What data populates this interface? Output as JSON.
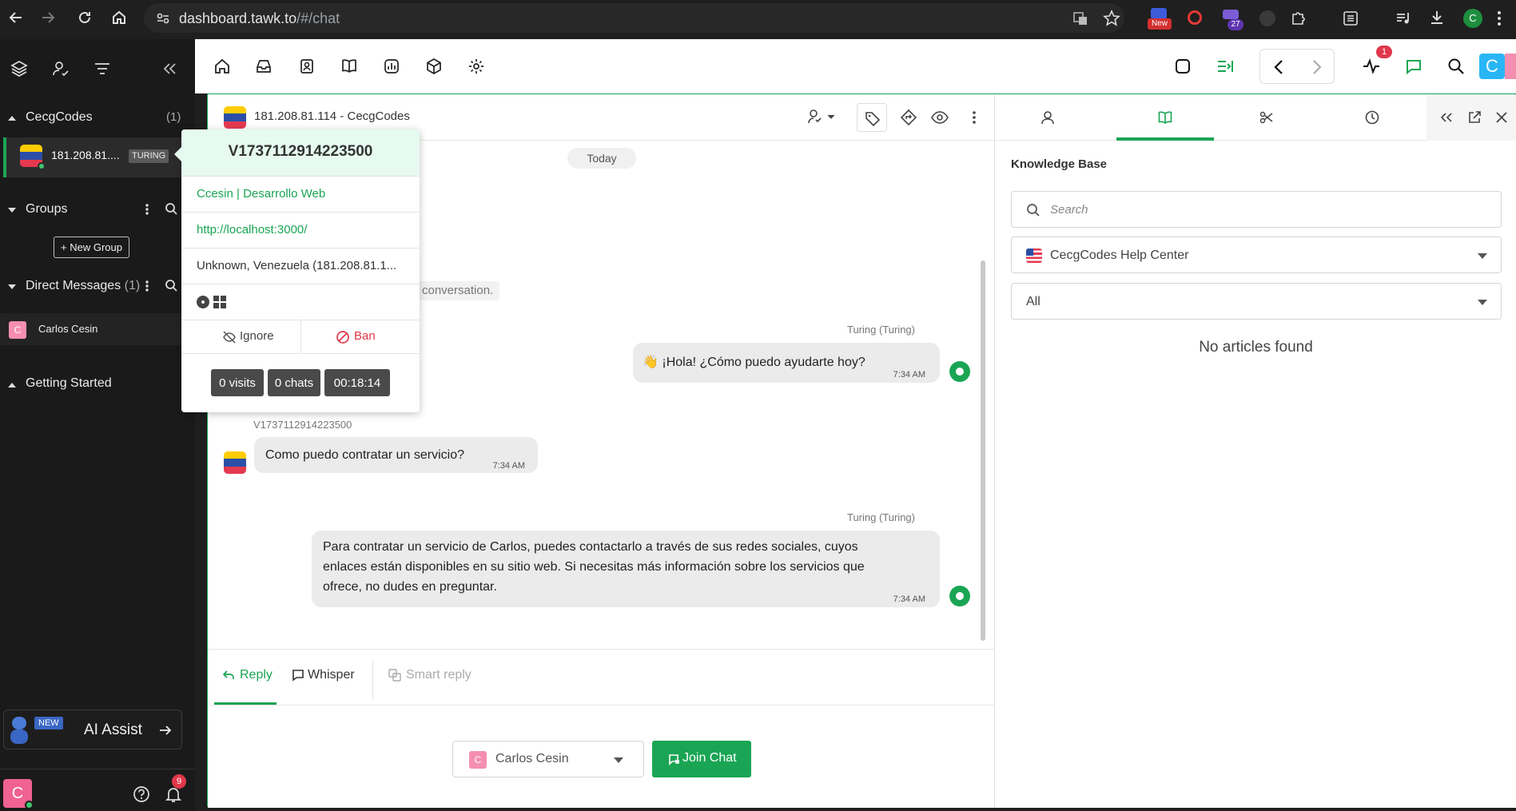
{
  "browser": {
    "url_host": "dashboard.tawk.to",
    "url_path": "/#/chat",
    "ext_badge_new": "New",
    "ext_badge_count": "27",
    "profile_initial": "C"
  },
  "sidebar": {
    "property_name": "CecgCodes",
    "property_count": "(1)",
    "active_chat": {
      "label": "181.208.81....",
      "badge": "TURING"
    },
    "groups_title": "Groups",
    "new_group_label": "New Group",
    "dm_title": "Direct Messages",
    "dm_count": "(1)",
    "dm_items": [
      {
        "initial": "C",
        "name": "Carlos Cesin"
      }
    ],
    "getting_started": "Getting Started",
    "ai_assist": {
      "new_badge": "NEW",
      "label": "AI Assist"
    },
    "user_initial": "C",
    "notification_count": "9"
  },
  "toolbar": {
    "activity_badge": "1",
    "user_initial": "C"
  },
  "chat": {
    "title": "181.208.81.114 - CecgCodes",
    "date_divider": "Today",
    "system_note": "conversation.",
    "messages": [
      {
        "sender": "Turing (Turing)",
        "text": "👋 ¡Hola! ¿Cómo puedo ayudarte hoy?",
        "time": "7:34 AM"
      },
      {
        "sender": "V1737112914223500",
        "text": "Como puedo contratar un servicio?",
        "time": "7:34 AM"
      },
      {
        "sender": "Turing (Turing)",
        "text_lines": [
          "Para contratar un servicio de Carlos, puedes contactarlo a través de sus redes sociales, cuyos",
          "enlaces están disponibles en su sitio web. Si necesitas más información sobre los servicios que",
          "ofrece, no dudes en preguntar."
        ],
        "time": "7:34 AM"
      }
    ]
  },
  "reply": {
    "tabs": [
      "Reply",
      "Whisper",
      "Smart reply"
    ],
    "agent_initial": "C",
    "agent_name": "Carlos Cesin",
    "join_label": "Join Chat"
  },
  "visitor_popover": {
    "visitor_id": "V1737112914223500",
    "site_name": "Ccesin | Desarrollo Web",
    "url": "http://localhost:3000/",
    "location": "Unknown, Venezuela (181.208.81.1...",
    "ignore_label": "Ignore",
    "ban_label": "Ban",
    "visits": "0 visits",
    "chats": "0 chats",
    "duration": "00:18:14"
  },
  "right_panel": {
    "heading": "Knowledge Base",
    "search_placeholder": "Search",
    "help_center": "CecgCodes Help Center",
    "filter": "All",
    "empty": "No articles found"
  },
  "colors": {
    "accent": "#1aa554",
    "danger": "#e0374a",
    "avatar_pink": "#f48fb1",
    "info_blue": "#29b6f6"
  }
}
